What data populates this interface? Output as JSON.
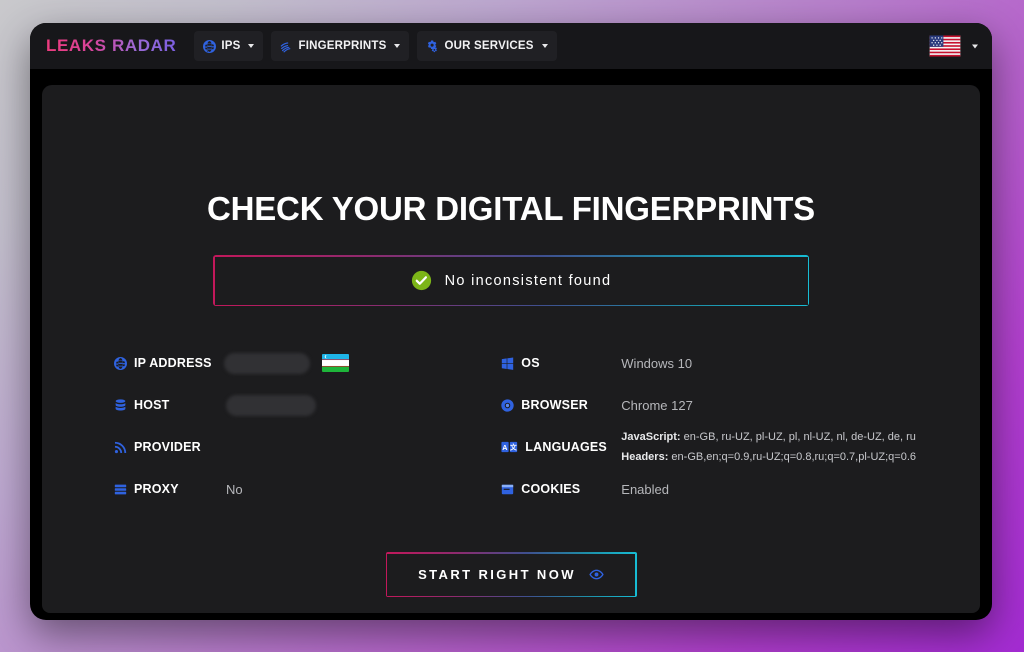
{
  "brand": {
    "logo_text": "LEAKS RADAR",
    "logo_gradient_start": "#ec3b7d",
    "logo_gradient_end": "#7b5fe0"
  },
  "nav": {
    "items": [
      {
        "label": "IPS",
        "icon": "globe-icon"
      },
      {
        "label": "FINGERPRINTS",
        "icon": "fingerprint-icon"
      },
      {
        "label": "OUR SERVICES",
        "icon": "gears-icon"
      }
    ],
    "language_picker": {
      "flag": "us-flag-icon",
      "caret": "chevron-down-icon"
    }
  },
  "main": {
    "title": "CHECK YOUR DIGITAL FINGERPRINTS",
    "status": {
      "text": "No inconsistent found",
      "icon": "check-circle-icon",
      "icon_color": "#7cb518",
      "border_gradient_start": "#c2185b",
      "border_gradient_end": "#17bcd4"
    },
    "left_column": [
      {
        "label": "IP ADDRESS",
        "icon": "globe-icon",
        "value": "",
        "redacted": true,
        "flag": "uz-flag-icon"
      },
      {
        "label": "HOST",
        "icon": "database-icon",
        "value": "",
        "redacted": true
      },
      {
        "label": "PROVIDER",
        "icon": "signal-icon",
        "value": ""
      },
      {
        "label": "PROXY",
        "icon": "server-icon",
        "value": "No"
      }
    ],
    "right_column": [
      {
        "label": "OS",
        "icon": "windows-icon",
        "value": "Windows 10"
      },
      {
        "label": "BROWSER",
        "icon": "chrome-icon",
        "value": "Chrome 127"
      },
      {
        "label": "LANGUAGES",
        "icon": "translate-icon",
        "javascript_key": "JavaScript:",
        "javascript_value": " en-GB, ru-UZ, pl-UZ, pl, nl-UZ, nl, de-UZ, de, ru",
        "headers_key": "Headers:",
        "headers_value": " en-GB,en;q=0.9,ru-UZ;q=0.8,ru;q=0.7,pl-UZ;q=0.6"
      },
      {
        "label": "COOKIES",
        "icon": "cookie-window-icon",
        "value": "Enabled"
      }
    ],
    "cta": {
      "label": "START RIGHT NOW",
      "icon": "eye-icon",
      "border_gradient_start": "#c2185b",
      "border_gradient_end": "#17bcd4"
    }
  }
}
